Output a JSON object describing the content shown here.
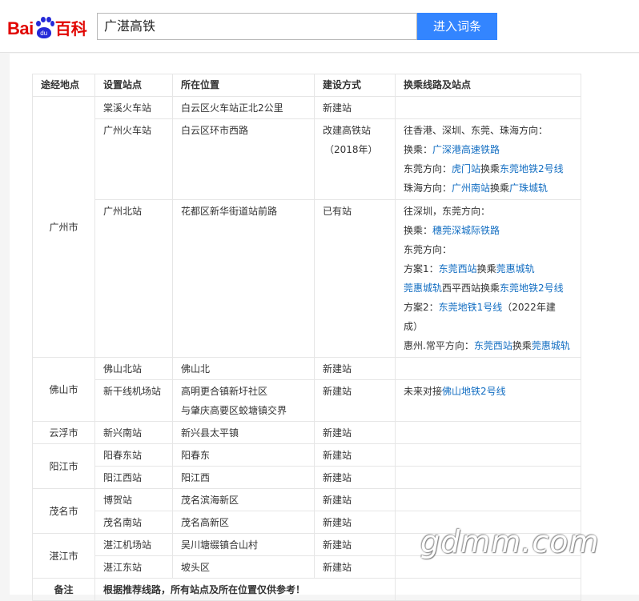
{
  "header": {
    "logo": {
      "bai": "Bai",
      "du": "du",
      "baike": "百科"
    },
    "search_value": "广湛高铁",
    "search_button": "进入词条"
  },
  "table": {
    "headers": [
      "途经地点",
      "设置站点",
      "所在位置",
      "建设方式",
      "换乘线路及站点"
    ],
    "cities": {
      "guangzhou": "广州市",
      "foshan": "佛山市",
      "yunfu": "云浮市",
      "yangjiang": "阳江市",
      "maoming": "茂名市",
      "zhanjiang": "湛江市"
    },
    "rows": {
      "r1": {
        "station": "棠溪火车站",
        "location": "白云区火车站正北2公里",
        "build": "新建站"
      },
      "r2": {
        "station": "广州火车站",
        "location": "白云区环市西路",
        "build": "改建高铁站",
        "build_note": "（2018年）",
        "t1": "往香港、深圳、东莞、珠海方向：",
        "t2a": "换乘：",
        "t2b": "广深港高速铁路",
        "t3a": "东莞方向：",
        "t3b": "虎门站",
        "t3c": "换乘",
        "t3d": "东莞地铁2号线",
        "t4a": "珠海方向：",
        "t4b": "广州南站",
        "t4c": "换乘",
        "t4d": "广珠城轨"
      },
      "r3": {
        "station": "广州北站",
        "location": "花都区新华街道站前路",
        "build": "已有站",
        "t1": "往深圳，东莞方向：",
        "t2a": "换乘：",
        "t2b": "穗莞深城际铁路",
        "t3": "东莞方向：",
        "t4a": "方案1：",
        "t4b": "东莞西站",
        "t4c": "换乘",
        "t4d": "莞惠城轨",
        "t5a": "莞惠城轨",
        "t5b": "西平西站换乘",
        "t5c": "东莞地铁2号线",
        "t6a": "方案2：",
        "t6b": "东莞地铁1号线",
        "t6c": "（2022年建",
        "t7": "成）",
        "t8a": "惠州.常平方向：",
        "t8b": "东莞西站",
        "t8c": "换乘",
        "t8d": "莞惠城轨"
      },
      "r4": {
        "station": "佛山北站",
        "location": "佛山北",
        "build": "新建站"
      },
      "r5": {
        "station": "新干线机场站",
        "location1": "高明更合镇新圩社区",
        "location2": "与肇庆高要区蛟塘镇交界",
        "build": "新建站",
        "t1a": "未来对接",
        "t1b": "佛山地铁2号线"
      },
      "r6": {
        "station": "新兴南站",
        "location": "新兴县太平镇",
        "build": "新建站"
      },
      "r7": {
        "station": "阳春东站",
        "location": "阳春东",
        "build": "新建站"
      },
      "r8": {
        "station": "阳江西站",
        "location": "阳江西",
        "build": "新建站"
      },
      "r9": {
        "station": "博贺站",
        "location": "茂名滨海新区",
        "build": "新建站"
      },
      "r10": {
        "station": "茂名南站",
        "location": "茂名高新区",
        "build": "新建站"
      },
      "r11": {
        "station": "湛江机场站",
        "location": "吴川塘缀镇合山村",
        "build": "新建站"
      },
      "r12": {
        "station": "湛江东站",
        "location": "坡头区",
        "build": "新建站"
      }
    },
    "note_label": "备注",
    "note_text": "根据推荐线路，所有站点及所在位置仅供参考！"
  },
  "watermark": "gdmm.com",
  "colors": {
    "link": "#136ec2",
    "button": "#3385ff",
    "logo_red": "#e10602",
    "logo_blue": "#2529d8"
  }
}
